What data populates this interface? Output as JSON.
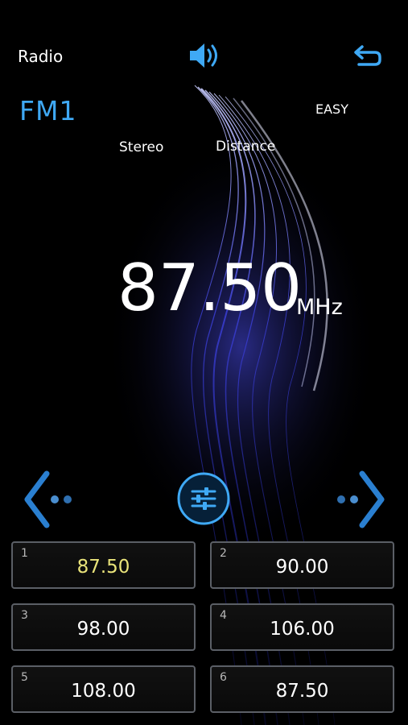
{
  "header": {
    "title": "Radio",
    "volume_icon": "speaker-icon",
    "back_icon": "back-arrow-icon"
  },
  "tuner": {
    "band": "FM1",
    "mode": "EASY",
    "stereo_label": "Stereo",
    "distance_label": "Distance",
    "frequency": "87.50",
    "unit": "MHz"
  },
  "controls": {
    "prev_icon": "chevron-left-icon",
    "next_icon": "chevron-right-icon",
    "settings_icon": "equalizer-sliders-icon"
  },
  "presets": [
    {
      "num": "1",
      "value": "87.50",
      "active": true
    },
    {
      "num": "2",
      "value": "90.00",
      "active": false
    },
    {
      "num": "3",
      "value": "98.00",
      "active": false
    },
    {
      "num": "4",
      "value": "106.00",
      "active": false
    },
    {
      "num": "5",
      "value": "108.00",
      "active": false
    },
    {
      "num": "6",
      "value": "87.50",
      "active": false
    }
  ],
  "colors": {
    "accent": "#3fa9f5",
    "active_preset": "#e9e37a",
    "background": "#000000"
  }
}
